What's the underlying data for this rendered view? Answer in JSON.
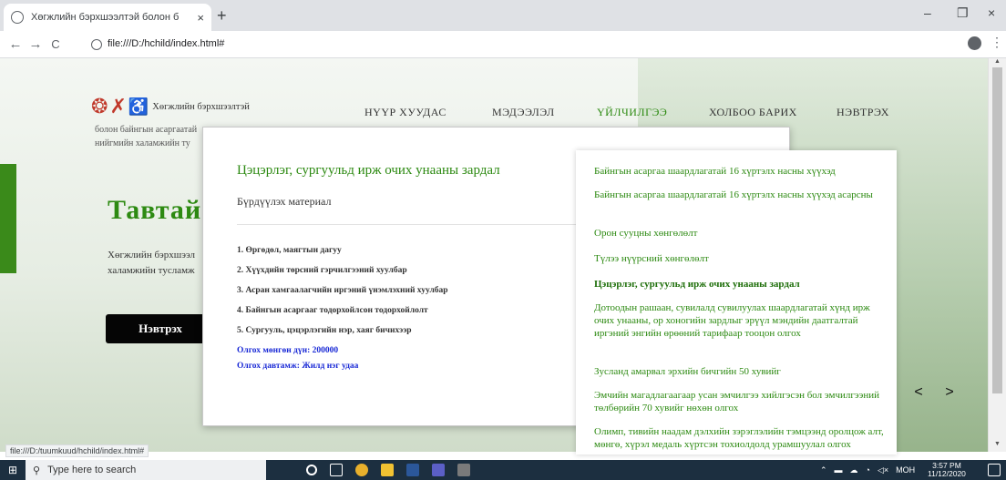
{
  "browser": {
    "tab_title": "Хөгжлийн бэрхшээлтэй болон б",
    "tab_close": "×",
    "new_tab": "+",
    "url": "file:///D:/hchild/index.html#",
    "minimize": "–",
    "restore": "❐",
    "close": "×",
    "back": "←",
    "forward": "→",
    "reload": "C",
    "menu": "⋮"
  },
  "site": {
    "logo_line1": "Хөгжлийн бэрхшээлтэй",
    "logo_line2": "болон байнгын асаргаатай",
    "logo_line3": "нийгмийн халамжийн ту",
    "nav": [
      "НҮҮР ХУУДАС",
      "МЭДЭЭЛЭЛ",
      "ҮЙЛЧИЛГЭЭ",
      "ХОЛБОО БАРИХ",
      "НЭВТРЭХ"
    ],
    "hero_title": "Тавтай",
    "hero_line1": "Хөгжлийн бэрхшээл",
    "hero_line2": "халамжийн тусламж",
    "hero_button": "Нэвтрэх",
    "prev": "<",
    "next": ">"
  },
  "modal": {
    "title": "Цэцэрлэг, сургуульд ирж очих унааны зардал",
    "subhead": "Бүрдүүлэх материал",
    "items": [
      "1. Өргөдөл, маягтын дагуу",
      "2. Хүүхдийн төрсний гэрчилгээний хуулбар",
      "3. Асран хамгаалагчийн иргэний үнэмлэхний хуулбар",
      "4. Байнгын асаргааг тодорхойлсон тодорхойлолт",
      "5. Сургууль, цэцэрлэгийн нэр, хаяг бичихээр"
    ],
    "amount": "Олгох мөнгөн дүн: 200000",
    "frequency": "Олгох давтамж: Жилд нэг удаа"
  },
  "sidelist": [
    "Байнгын асаргаа шаардлагатай 16 хүртэлх насны хүүхэд",
    "Байнгын асаргаа шаардлагатай 16 хүртэлх насны хүүхэд асарсны",
    "Орон сууцны хөнгөлөлт",
    "Түлээ нүүрсний хөнгөлөлт",
    "Цэцэрлэг, сургуульд ирж очих унааны зардал",
    "Дотоодын рашаан, сувилалд сувилуулах шаардлагатай хүнд ирж очих унааны, ор хоногийн зардлыг эрүүл мэндийн даатгалтай иргэний энгийн өрөөний тарифаар тооцон олгох",
    "Зусланд амарвал эрхийн бичгийн 50 хувийг",
    "Эмчийн магадлагаагаар усан эмчилгээ хийлгэсэн бол эмчилгээний төлбөрийн 70 хувийг нөхөн олгох",
    "Олимп, тивийн наадам дэлхийн зэрэглэлийн тэмцээнд оролцож алт, мөнгө, хүрэл медаль хүртсэн тохиолдолд урамшуулал олгох"
  ],
  "statusbar": "file:///D:/tuumkuud/hchild/index.html#",
  "taskbar": {
    "search_placeholder": "Type here to search",
    "lang": "МОН",
    "time": "3:57 PM",
    "date": "11/12/2020"
  },
  "colors": {
    "accent_green": "#2d8a12",
    "link_blue": "#1a2ad6",
    "button_black": "#050505"
  }
}
